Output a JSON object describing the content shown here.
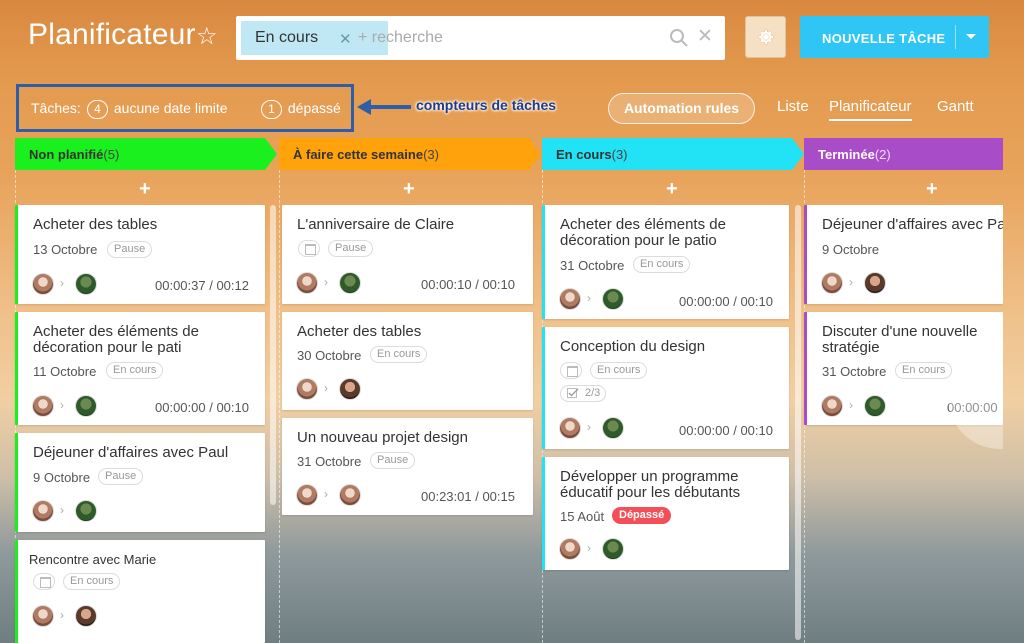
{
  "header": {
    "title": "Planificateur",
    "search_chip": "En cours",
    "search_placeholder": "+ recherche",
    "new_task_label": "NOUVELLE TÂCHE"
  },
  "counters": {
    "prefix": "Tâches:",
    "no_deadline_count": "4",
    "no_deadline_label": "aucune date limite",
    "overdue_count": "1",
    "overdue_label": "dépassé",
    "callout": "compteurs de tâches"
  },
  "toolbar": {
    "automation_label": "Automation rules",
    "views": [
      "Liste",
      "Planificateur",
      "Gantt"
    ],
    "active_view": "Planificateur"
  },
  "stages": [
    {
      "name": "Non planifié",
      "count": "(5)",
      "color": "#19f01e"
    },
    {
      "name": "À faire cette semaine",
      "count": "(3)",
      "color": "#ffa20c"
    },
    {
      "name": "En cours",
      "count": "(3)",
      "color": "#22e3f5"
    },
    {
      "name": "Terminée",
      "count": "(2)",
      "color": "#a94cc7"
    }
  ],
  "cards": {
    "c1": {
      "title": "Acheter des tables",
      "date": "13 Octobre",
      "tag": "Pause",
      "time": "00:00:37 / 00:12"
    },
    "c2": {
      "title1": "Acheter des éléments de",
      "title2": "décoration pour le pati",
      "date": "11 Octobre",
      "tag": "En cours",
      "time": "00:00:00 / 00:10"
    },
    "c3": {
      "title": "Déjeuner d'affaires avec Paul",
      "date": "9 Octobre",
      "tag": "Pause"
    },
    "c4": {
      "title": "Rencontre avec Marie",
      "tag": "En cours"
    },
    "c5": {
      "title": "L'anniversaire de Claire",
      "tag": "Pause",
      "time": "00:00:10 / 00:10"
    },
    "c6": {
      "title": "Acheter des tables",
      "date": "30 Octobre",
      "tag": "En cours"
    },
    "c7": {
      "title": "Un nouveau projet design",
      "date": "31 Octobre",
      "tag": "Pause",
      "time": "00:23:01 / 00:15"
    },
    "c8": {
      "title1": "Acheter des éléments de",
      "title2": "décoration pour le patio",
      "date": "31 Octobre",
      "tag": "En cours",
      "time": "00:00:00 / 00:10"
    },
    "c9": {
      "title": "Conception du design",
      "tag": "En cours",
      "checklist": "2/3",
      "time": "00:00:00 / 00:10"
    },
    "c10": {
      "title1": "Développer un programme",
      "title2": "éducatif pour les débutants",
      "date": "15 Août",
      "tag": "Dépassé"
    },
    "c11": {
      "title": "Déjeuner d'affaires avec Pa",
      "date": "9 Octobre"
    },
    "c12": {
      "title1": "Discuter d'une nouvelle",
      "title2": "stratégie",
      "date": "31 Octobre",
      "tag": "En cours",
      "time": "00:00:00"
    }
  }
}
